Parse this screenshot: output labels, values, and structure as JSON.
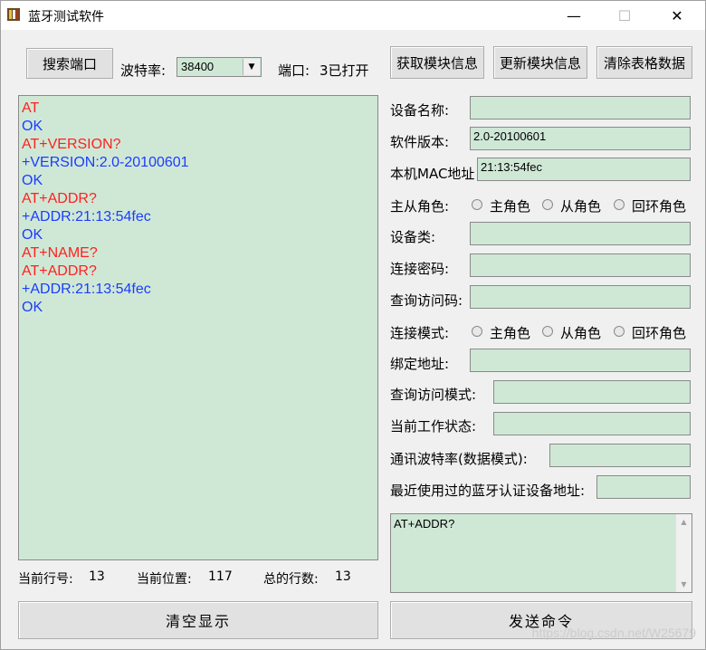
{
  "window": {
    "title": "蓝牙测试软件",
    "minimize_glyph": "—",
    "maximize_glyph": "☐",
    "close_glyph": "✕"
  },
  "toolbar": {
    "search_port": "搜索端口",
    "baud_label": "波特率:",
    "baud_value": "38400",
    "port_label": "端口:",
    "port_status": "3已打开",
    "get_info": "获取模块信息",
    "update_info": "更新模块信息",
    "clear_table": "清除表格数据"
  },
  "log": {
    "lines": [
      {
        "text": "AT",
        "color": "#ff2020"
      },
      {
        "text": "OK",
        "color": "#1c3cff"
      },
      {
        "text": "AT+VERSION?",
        "color": "#ff2020"
      },
      {
        "text": "+VERSION:2.0-20100601",
        "color": "#1c3cff"
      },
      {
        "text": "OK",
        "color": "#1c3cff"
      },
      {
        "text": "AT+ADDR?",
        "color": "#ff2020"
      },
      {
        "text": "+ADDR:21:13:54fec",
        "color": "#1c3cff"
      },
      {
        "text": "OK",
        "color": "#1c3cff"
      },
      {
        "text": "AT+NAME?",
        "color": "#ff2020"
      },
      {
        "text": "AT+ADDR?",
        "color": "#ff2020"
      },
      {
        "text": "+ADDR:21:13:54fec",
        "color": "#1c3cff"
      },
      {
        "text": "OK",
        "color": "#1c3cff"
      }
    ]
  },
  "form": {
    "device_name_label": "设备名称:",
    "device_name_value": "",
    "software_version_label": "软件版本:",
    "software_version_value": "2.0-20100601",
    "mac_label": "本机MAC地址",
    "mac_value": "21:13:54fec",
    "role_label": "主从角色:",
    "role_master": "主角色",
    "role_slave": "从角色",
    "role_loop": "回环角色",
    "device_class_label": "设备类:",
    "device_class_value": "",
    "pin_label": "连接密码:",
    "pin_value": "",
    "inquiry_code_label": "查询访问码:",
    "inquiry_code_value": "",
    "conn_mode_label": "连接模式:",
    "conn_mode_master": "主角色",
    "conn_mode_slave": "从角色",
    "conn_mode_loop": "回环角色",
    "bind_addr_label": "绑定地址:",
    "bind_addr_value": "",
    "inquiry_mode_label": "查询访问模式:",
    "inquiry_mode_value": "",
    "work_state_label": "当前工作状态:",
    "work_state_value": "",
    "baud_data_label": "通讯波特率(数据模式):",
    "baud_data_value": "",
    "recent_addr_label": "最近使用过的蓝牙认证设备地址:",
    "recent_addr_value": ""
  },
  "command": {
    "text": "AT+ADDR?"
  },
  "status": {
    "line_label": "当前行号:",
    "line_value": "13",
    "pos_label": "当前位置:",
    "pos_value": "117",
    "total_label": "总的行数:",
    "total_value": "13"
  },
  "bottom": {
    "clear_display": "清空显示",
    "send_command": "发送命令"
  },
  "watermark": "https://blog.csdn.net/W25679"
}
